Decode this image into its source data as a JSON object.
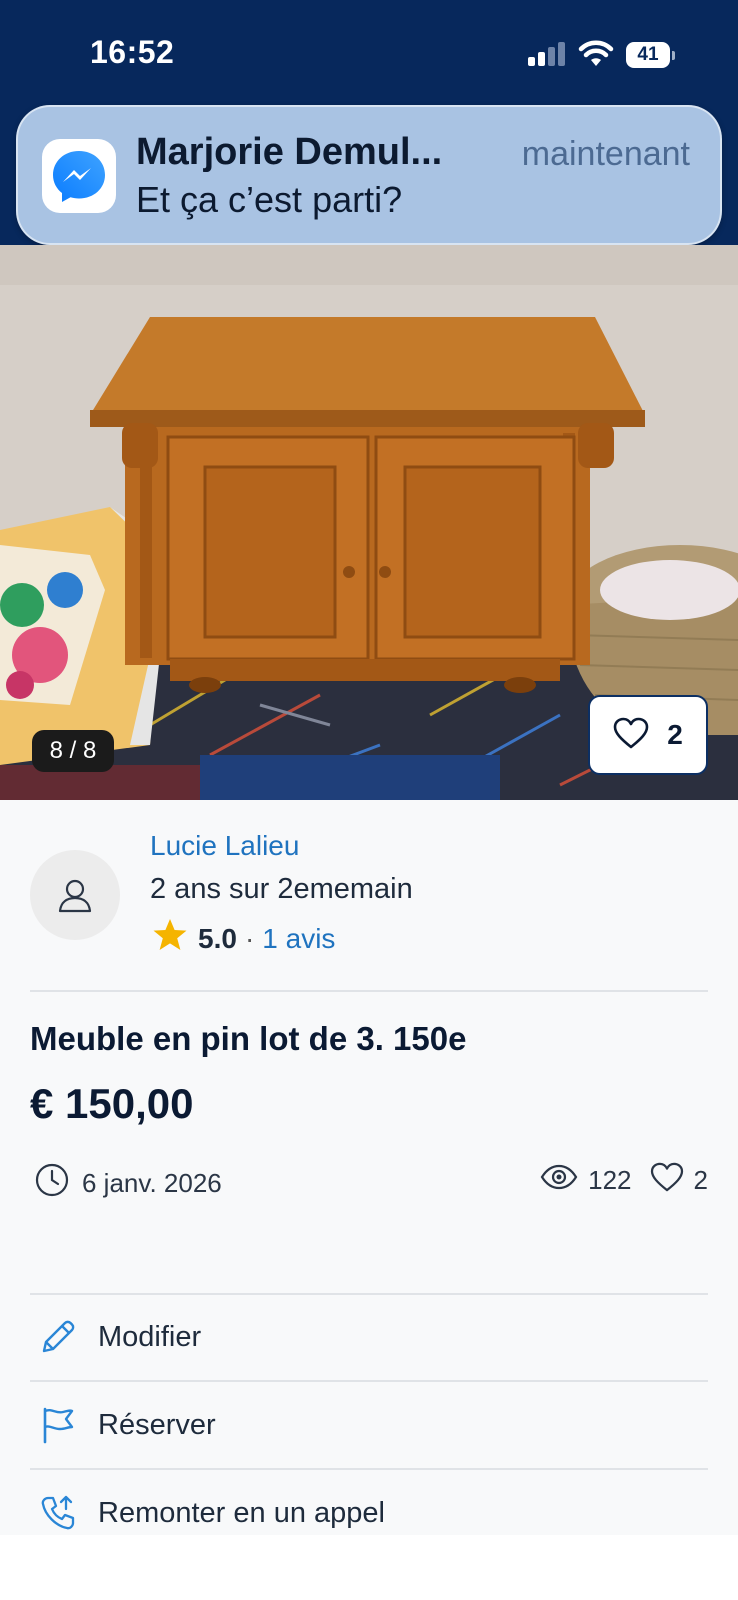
{
  "status_bar": {
    "time": "16:52",
    "battery": "41"
  },
  "notification": {
    "app_icon": "messenger-icon",
    "sender": "Marjorie Demul...",
    "time": "maintenant",
    "message": "Et ça c’est parti?"
  },
  "photo": {
    "counter": "8 / 8",
    "favorite_count": "2"
  },
  "seller": {
    "name": "Lucie Lalieu",
    "member_since": "2 ans sur 2ememain",
    "rating": "5.0",
    "reviews": "1 avis"
  },
  "listing": {
    "title": "Meuble en pin lot de 3. 150e",
    "price": "€ 150,00",
    "date": "6 janv. 2026",
    "views": "122",
    "favorites": "2"
  },
  "actions": [
    {
      "label": "Modifier",
      "icon": "pencil-icon"
    },
    {
      "label": "Réserver",
      "icon": "flag-icon"
    },
    {
      "label": "Remonter en un appel",
      "icon": "phone-up-icon"
    }
  ],
  "colors": {
    "header_bg": "#07285c",
    "link": "#1f73bf",
    "star": "#f5b400",
    "icon_blue": "#2a86d6"
  }
}
